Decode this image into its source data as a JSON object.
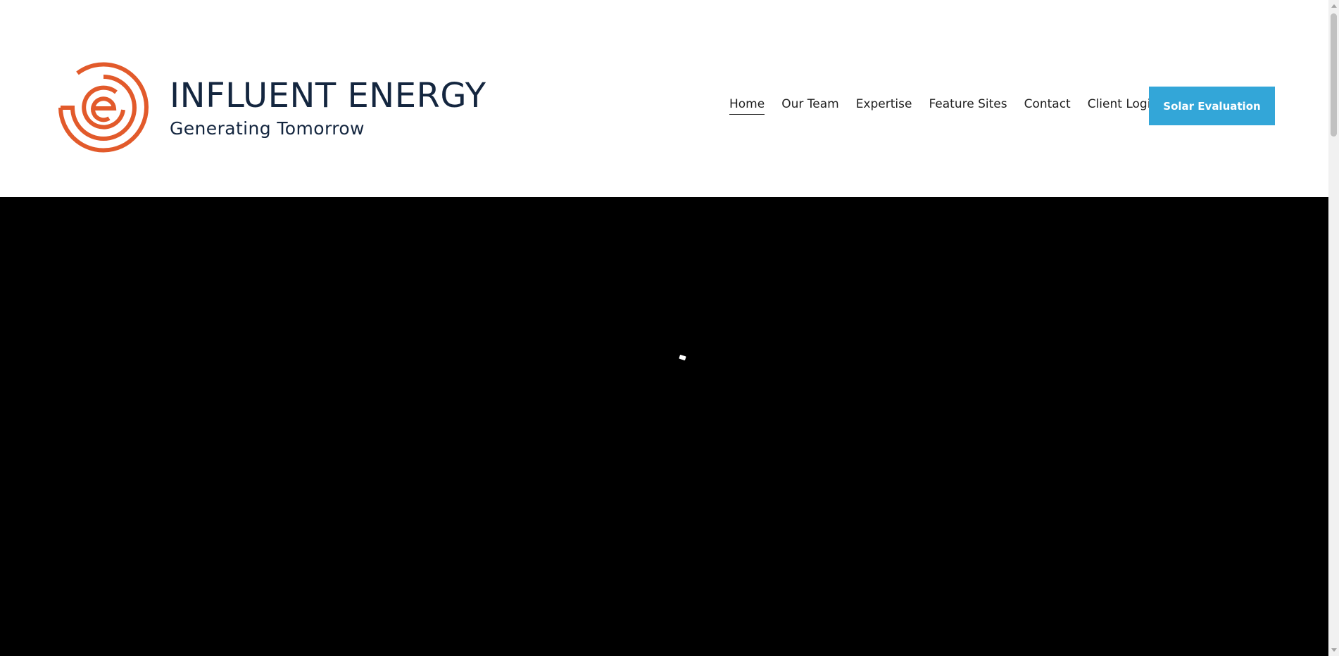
{
  "brand": {
    "name": "INFLUENT ENERGY",
    "tagline": "Generating Tomorrow",
    "logo_icon": "concentric-e-icon",
    "colors": {
      "logo_mark": "#e25a2b",
      "logo_text": "#14263f"
    }
  },
  "nav": {
    "items": [
      {
        "label": "Home",
        "active": true
      },
      {
        "label": "Our Team",
        "active": false
      },
      {
        "label": "Expertise",
        "active": false
      },
      {
        "label": "Feature Sites",
        "active": false
      },
      {
        "label": "Contact",
        "active": false
      },
      {
        "label": "Client Login",
        "active": false
      }
    ],
    "cta_label": "Solar Evaluation",
    "cta_color": "#33a6d8"
  },
  "hero": {
    "background": "#000000",
    "loading_icon": "loading-spinner-icon"
  }
}
